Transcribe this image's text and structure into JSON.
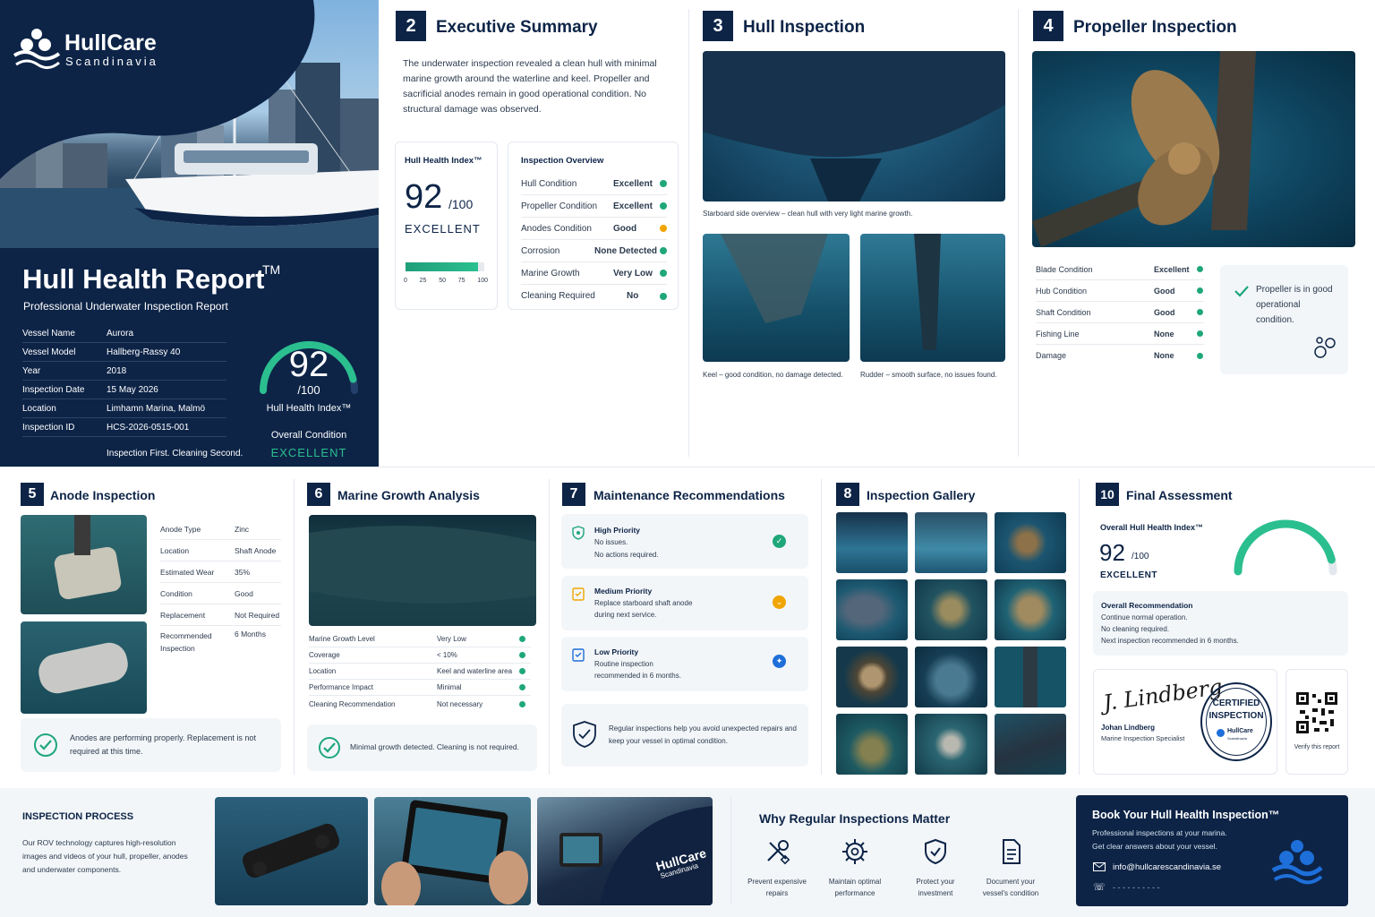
{
  "brand": {
    "name": "HullCare",
    "sub": "Scandinavia"
  },
  "cover": {
    "title": "Hull Health Report",
    "tm": "TM",
    "subtitle": "Professional Underwater Inspection Report",
    "fields": [
      {
        "label": "Vessel Name",
        "value": "Aurora"
      },
      {
        "label": "Vessel Model",
        "value": "Hallberg-Rassy 40"
      },
      {
        "label": "Year",
        "value": "2018"
      },
      {
        "label": "Inspection Date",
        "value": "15 May 2026"
      },
      {
        "label": "Location",
        "value": "Limhamn Marina, Malmö"
      },
      {
        "label": "Inspection ID",
        "value": "HCS-2026-0515-001"
      }
    ],
    "tagline": "Inspection First. Cleaning Second.",
    "score": "92",
    "score_max": "/100",
    "index_label": "Hull Health Index™",
    "overall_label": "Overall Condition",
    "overall_value": "EXCELLENT",
    "score_fraction": 0.92
  },
  "s2": {
    "num": "2",
    "title": "Executive Summary",
    "text": "The underwater inspection revealed a clean hull with minimal marine growth around the waterline and keel. Propeller and sacrificial anodes remain in good operational condition. No structural damage was observed.",
    "index_card": {
      "title": "Hull Health Index™",
      "score": "92",
      "max": "/100",
      "rating": "EXCELLENT",
      "ticks": [
        "0",
        "25",
        "50",
        "75",
        "100"
      ],
      "fraction": 0.92
    },
    "overview": {
      "title": "Inspection Overview",
      "rows": [
        {
          "label": "Hull Condition",
          "value": "Excellent",
          "status": "green"
        },
        {
          "label": "Propeller Condition",
          "value": "Excellent",
          "status": "green"
        },
        {
          "label": "Anodes Condition",
          "value": "Good",
          "status": "amber"
        },
        {
          "label": "Corrosion",
          "value": "None Detected",
          "status": "green"
        },
        {
          "label": "Marine Growth",
          "value": "Very Low",
          "status": "green"
        },
        {
          "label": "Cleaning Required",
          "value": "No",
          "status": "green"
        }
      ]
    }
  },
  "s3": {
    "num": "3",
    "title": "Hull Inspection",
    "caption_main": "Starboard side overview – clean hull with very light marine growth.",
    "caption_keel": "Keel – good condition, no damage detected.",
    "caption_rudder": "Rudder – smooth surface, no issues found."
  },
  "s4": {
    "num": "4",
    "title": "Propeller Inspection",
    "rows": [
      {
        "label": "Blade Condition",
        "value": "Excellent"
      },
      {
        "label": "Hub Condition",
        "value": "Good"
      },
      {
        "label": "Shaft Condition",
        "value": "Good"
      },
      {
        "label": "Fishing Line",
        "value": "None"
      },
      {
        "label": "Damage",
        "value": "None"
      }
    ],
    "note": "Propeller is in good operational condition."
  },
  "s5": {
    "num": "5",
    "title": "Anode Inspection",
    "rows": [
      {
        "label": "Anode Type",
        "value": "Zinc"
      },
      {
        "label": "Location",
        "value": "Shaft Anode"
      },
      {
        "label": "Estimated Wear",
        "value": "35%"
      },
      {
        "label": "Condition",
        "value": "Good"
      },
      {
        "label": "Replacement",
        "value": "Not Required"
      },
      {
        "label": "Recommended Inspection",
        "value": "6 Months"
      }
    ],
    "note": "Anodes are performing properly. Replacement is not required at this time."
  },
  "s6": {
    "num": "6",
    "title": "Marine Growth Analysis",
    "rows": [
      {
        "label": "Marine Growth Level",
        "value": "Very Low"
      },
      {
        "label": "Coverage",
        "value": "< 10%"
      },
      {
        "label": "Location",
        "value": "Keel and waterline area"
      },
      {
        "label": "Performance Impact",
        "value": "Minimal"
      },
      {
        "label": "Cleaning Recommendation",
        "value": "Not necessary"
      }
    ],
    "note": "Minimal growth detected. Cleaning is not required."
  },
  "s7": {
    "num": "7",
    "title": "Maintenance Recommendations",
    "items": [
      {
        "title": "High Priority",
        "line1": "No issues.",
        "line2": "No actions required."
      },
      {
        "title": "Medium Priority",
        "line1": "Replace starboard shaft anode",
        "line2": "during next service."
      },
      {
        "title": "Low Priority",
        "line1": "Routine inspection",
        "line2": "recommended in 6 months."
      }
    ],
    "note": "Regular inspections help you avoid unexpected repairs and keep your vessel in optimal condition."
  },
  "s8": {
    "num": "8",
    "title": "Inspection Gallery"
  },
  "s10": {
    "num": "10",
    "title": "Final Assessment",
    "index_label": "Overall Hull Health Index™",
    "score": "92",
    "max": "/100",
    "rating": "EXCELLENT",
    "fraction": 0.92,
    "rec_title": "Overall Recommendation",
    "rec_lines": [
      "Continue normal operation.",
      "No cleaning required.",
      "Next inspection recommended in 6 months."
    ],
    "signature": "J. Lindberg",
    "signer": "Johan Lindberg",
    "signer_role": "Marine Inspection Specialist",
    "stamp_line1": "CERTIFIED",
    "stamp_line2": "INSPECTION",
    "stamp_brand": "HullCare",
    "stamp_sub": "Scandinavia",
    "verify": "Verify this report"
  },
  "process": {
    "title": "INSPECTION PROCESS",
    "text": "Our ROV technology captures high-resolution images and videos of your hull, propeller, anodes and underwater components.",
    "jacket_brand": "HullCare",
    "jacket_sub": "Scandinavia"
  },
  "why": {
    "title": "Why Regular Inspections Matter",
    "items": [
      {
        "l1": "Prevent expensive",
        "l2": "repairs"
      },
      {
        "l1": "Maintain optimal",
        "l2": "performance"
      },
      {
        "l1": "Protect your",
        "l2": "investment"
      },
      {
        "l1": "Document your",
        "l2": "vessel's condition"
      }
    ]
  },
  "book": {
    "title": "Book Your Hull Health Inspection™",
    "l1": "Professional inspections at your marina.",
    "l2": "Get clear answers about your vessel.",
    "email": "info@hullcarescandinavia.se",
    "phone": "- - - - - - - - - -"
  },
  "colors": {
    "navy": "#0d2447",
    "green": "#1fa77a",
    "amber": "#f0a500",
    "blue": "#1e6fd9"
  }
}
